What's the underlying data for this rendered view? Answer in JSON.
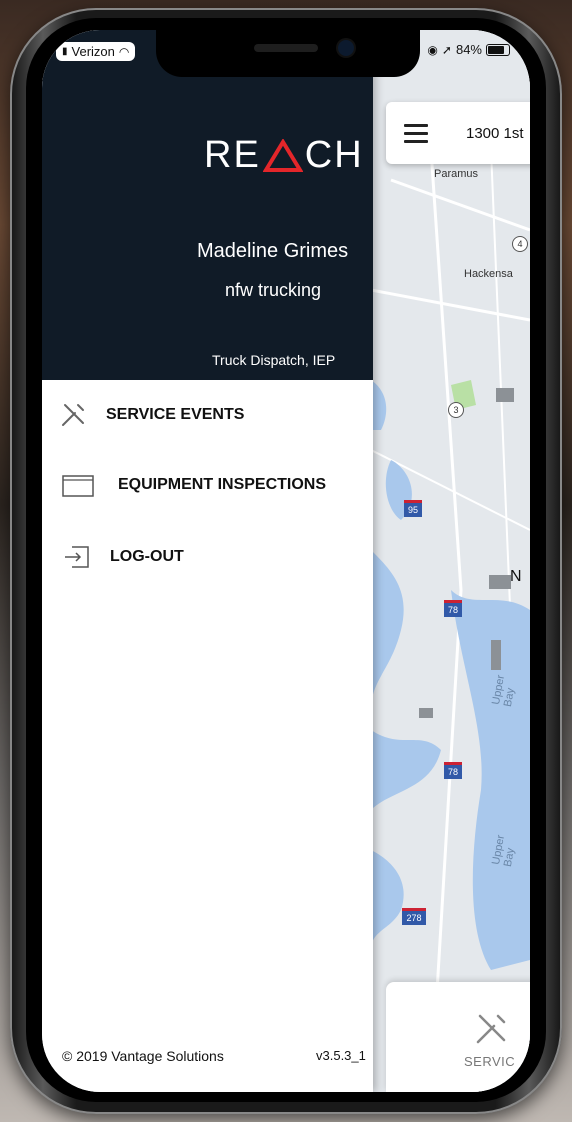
{
  "status_bar": {
    "carrier": "Verizon",
    "battery_percent": "84%"
  },
  "drawer": {
    "logo_left": "RE",
    "logo_right": "CH",
    "user_name": "Madeline Grimes",
    "company": "nfw trucking",
    "role": "Truck Dispatch, IEP",
    "menu": [
      {
        "label": "SERVICE EVENTS",
        "icon": "tools-icon"
      },
      {
        "label": "EQUIPMENT INSPECTIONS",
        "icon": "inspection-card-icon"
      },
      {
        "label": "LOG-OUT",
        "icon": "logout-icon"
      }
    ],
    "footer_copyright": "© 2019 Vantage Solutions",
    "footer_version": "v3.5.3_1"
  },
  "map": {
    "search_address": "1300 1st",
    "labels": [
      "Paramus",
      "Hackensa",
      "Upper Bay",
      "Upper Bay",
      "N"
    ],
    "route_shields": [
      "4",
      "3",
      "95",
      "78",
      "78",
      "278"
    ],
    "bottom_card_label": "SERVIC"
  },
  "colors": {
    "drawer_header_bg": "#101b27",
    "logo_accent": "#e4262a",
    "water": "#a9c8ec",
    "land": "#e4e8ec"
  }
}
